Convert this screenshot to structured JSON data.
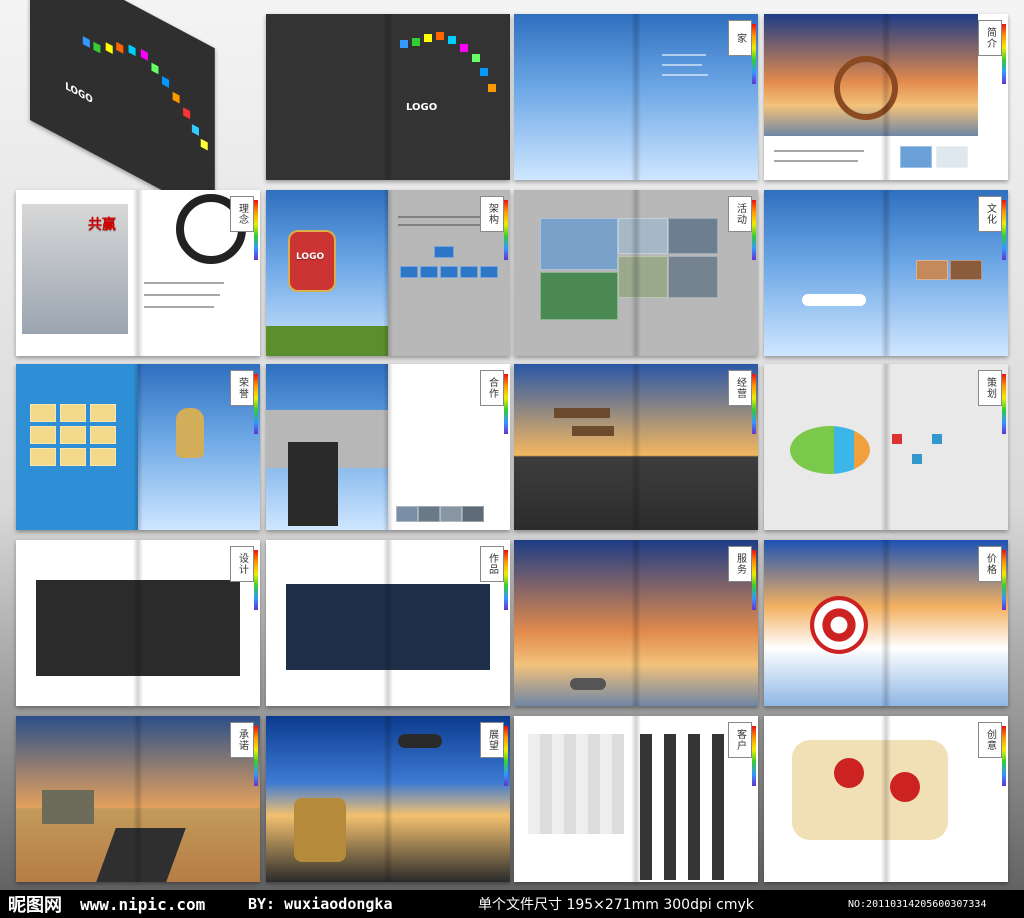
{
  "spreads": [
    {
      "id": "cover",
      "title": "",
      "badge": "",
      "left_text": "LOGO",
      "sub": "",
      "right_text": ""
    },
    {
      "id": "inner-cover",
      "title": "",
      "badge": "",
      "left_text": "",
      "sub": "",
      "right_text": "LOGO"
    },
    {
      "id": "home",
      "title": "",
      "badge": "家",
      "left_text": "",
      "sub": "",
      "right_text": ""
    },
    {
      "id": "intro",
      "title": "",
      "badge": "简介",
      "left_text": "",
      "sub": "",
      "right_text": ""
    },
    {
      "id": "idea",
      "title": "",
      "badge": "理念",
      "left_text": "共赢",
      "sub": "",
      "right_text": ""
    },
    {
      "id": "structure",
      "title": "",
      "badge": "架构",
      "left_text": "LOGO",
      "sub": "",
      "right_text": ""
    },
    {
      "id": "activities",
      "title": "",
      "badge": "活动",
      "left_text": "",
      "sub": "",
      "right_text": ""
    },
    {
      "id": "culture",
      "title": "",
      "badge": "文化",
      "left_text": "",
      "sub": "",
      "right_text": ""
    },
    {
      "id": "honor",
      "title": "",
      "badge": "荣誉",
      "left_text": "",
      "sub": "",
      "right_text": ""
    },
    {
      "id": "cooperation",
      "title": "",
      "badge": "合作",
      "left_text": "",
      "sub": "",
      "right_text": ""
    },
    {
      "id": "operation",
      "title": "",
      "badge": "经营",
      "left_text": "",
      "sub": "",
      "right_text": ""
    },
    {
      "id": "planning",
      "title": "",
      "badge": "策划",
      "left_text": "",
      "sub": "",
      "right_text": ""
    },
    {
      "id": "design",
      "title": "",
      "badge": "设计",
      "left_text": "",
      "sub": "",
      "right_text": ""
    },
    {
      "id": "works",
      "title": "",
      "badge": "作品",
      "left_text": "",
      "sub": "",
      "right_text": ""
    },
    {
      "id": "service",
      "title": "",
      "badge": "服务",
      "left_text": "",
      "sub": "",
      "right_text": ""
    },
    {
      "id": "price",
      "title": "",
      "badge": "价格",
      "left_text": "",
      "sub": "",
      "right_text": ""
    },
    {
      "id": "faith",
      "title": "",
      "badge": "承诺",
      "left_text": "",
      "sub": "",
      "right_text": ""
    },
    {
      "id": "exhibit",
      "title": "",
      "badge": "展望",
      "left_text": "",
      "sub": "",
      "right_text": ""
    },
    {
      "id": "clients",
      "title": "",
      "badge": "客户",
      "left_text": "",
      "sub": "",
      "right_text": ""
    },
    {
      "id": "creative",
      "title": "",
      "badge": "创意",
      "left_text": "",
      "sub": "",
      "right_text": ""
    }
  ],
  "footer": {
    "brand": "昵图网",
    "site": "www.nipic.com",
    "by": "BY: wuxiaodongka",
    "size": "单个文件尺寸 195×271mm 300dpi cmyk",
    "no": "NO:20110314205600307334"
  }
}
